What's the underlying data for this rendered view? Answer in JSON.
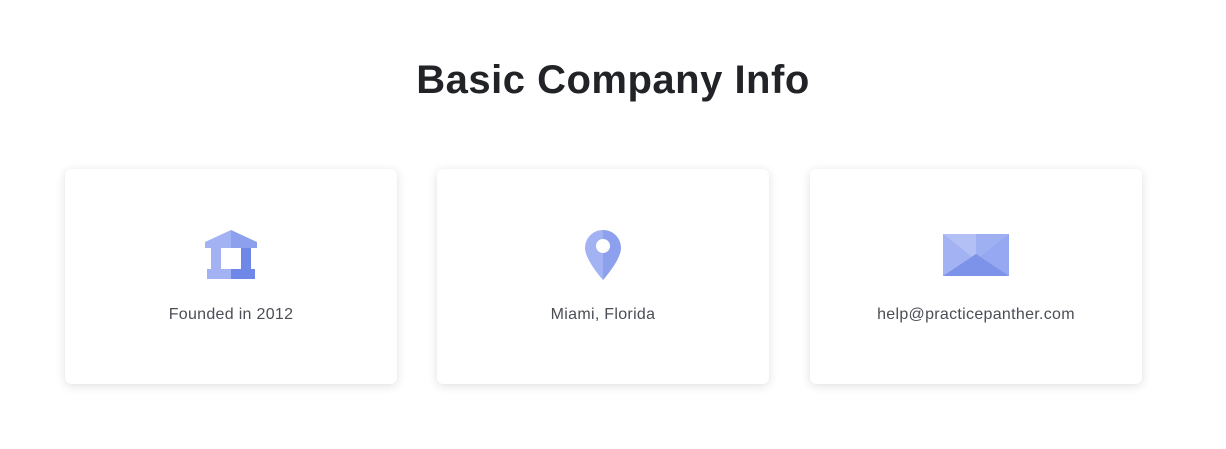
{
  "title": "Basic Company Info",
  "accent_colors": {
    "light": "#a2b2f3",
    "medium": "#8ca0ee",
    "dark": "#6f87e6"
  },
  "cards": [
    {
      "icon": "bank-building-icon",
      "text": "Founded in 2012"
    },
    {
      "icon": "map-pin-icon",
      "text": "Miami, Florida"
    },
    {
      "icon": "envelope-icon",
      "text": "help@practicepanther.com"
    }
  ]
}
